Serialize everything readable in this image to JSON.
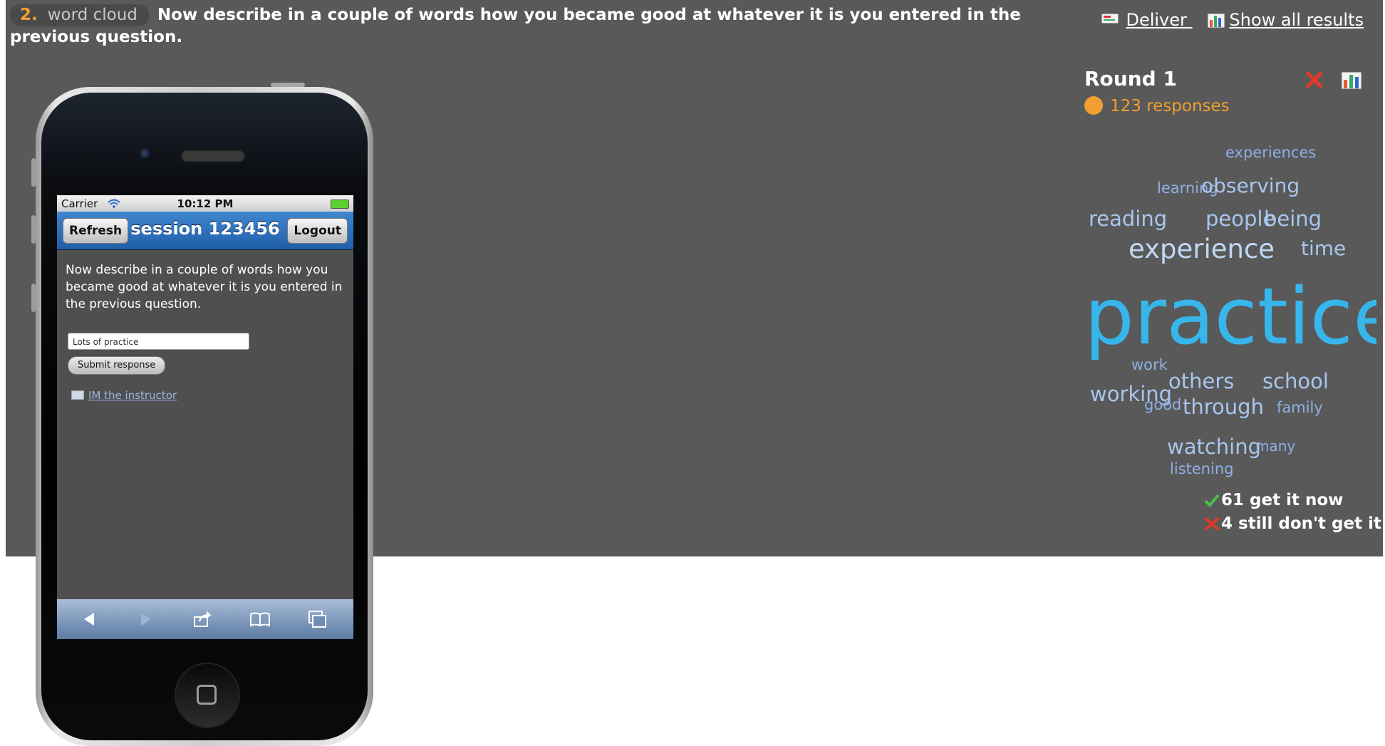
{
  "question": {
    "number": "2.",
    "type": "word cloud",
    "text": "Now describe in a couple of words how you became good at whatever it is you entered in the previous question."
  },
  "links": {
    "deliver": "Deliver",
    "show_all": "Show all results"
  },
  "phone": {
    "carrier": "Carrier",
    "time": "10:12 PM",
    "refresh": "Refresh",
    "title": "session 123456",
    "logout": "Logout",
    "prompt": "Now describe in a couple of words how you became good at whatever it is you entered in the previous question.",
    "input_value": "Lots of practice",
    "submit": "Submit response",
    "im": "IM the instructor"
  },
  "results": {
    "round": "Round 1",
    "responses": "123 responses",
    "words": [
      {
        "t": "experiences",
        "c": "#8fb0e6"
      },
      {
        "t": "learning",
        "c": "#8fb0e6"
      },
      {
        "t": "observing",
        "c": "#a8c6ee"
      },
      {
        "t": "reading",
        "c": "#a8c6ee"
      },
      {
        "t": "people",
        "c": "#a8c6ee"
      },
      {
        "t": "being",
        "c": "#a8c6ee"
      },
      {
        "t": "experience",
        "c": "#c0d8f4"
      },
      {
        "t": "time",
        "c": "#a8c6ee"
      },
      {
        "t": "practice",
        "c": "#37b6ec"
      },
      {
        "t": "work",
        "c": "#8fb0e6"
      },
      {
        "t": "others",
        "c": "#a8c6ee"
      },
      {
        "t": "school",
        "c": "#a8c6ee"
      },
      {
        "t": "working",
        "c": "#a8c6ee"
      },
      {
        "t": "good",
        "c": "#8fb0e6"
      },
      {
        "t": "through",
        "c": "#a8c6ee"
      },
      {
        "t": "family",
        "c": "#8fb0e6"
      },
      {
        "t": "watching",
        "c": "#a8c6ee"
      },
      {
        "t": "many",
        "c": "#8fb0e6"
      },
      {
        "t": "listening",
        "c": "#8fb0e6"
      }
    ],
    "get_it": "61 get it now",
    "dont_get": "4 still don't get it"
  },
  "colors": {
    "panel": "#595959",
    "accent": "#f0a030",
    "cloud_main": "#37b6ec"
  }
}
